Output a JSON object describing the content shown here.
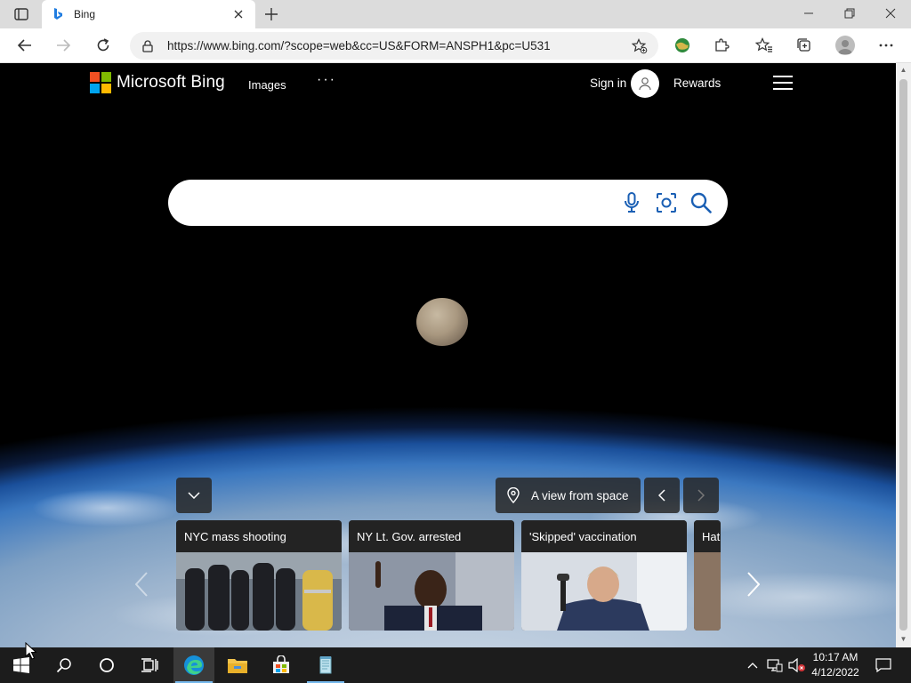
{
  "browser": {
    "tab_title": "Bing",
    "url": "https://www.bing.com/?scope=web&cc=US&FORM=ANSPH1&pc=U531"
  },
  "bing": {
    "logo_text": "Microsoft Bing",
    "nav_images": "Images",
    "nav_more": "···",
    "sign_in": "Sign in",
    "rewards": "Rewards",
    "search_placeholder": "",
    "location_label": "A view from space",
    "brand_colors": {
      "red": "#f25022",
      "green": "#7fba00",
      "blue": "#00a4ef",
      "yellow": "#ffb900"
    }
  },
  "news": [
    {
      "title": "NYC mass shooting"
    },
    {
      "title": "NY Lt. Gov. arrested"
    },
    {
      "title": "'Skipped' vaccination"
    },
    {
      "title": "Hat"
    }
  ],
  "taskbar": {
    "time": "10:17 AM",
    "date": "4/12/2022"
  }
}
